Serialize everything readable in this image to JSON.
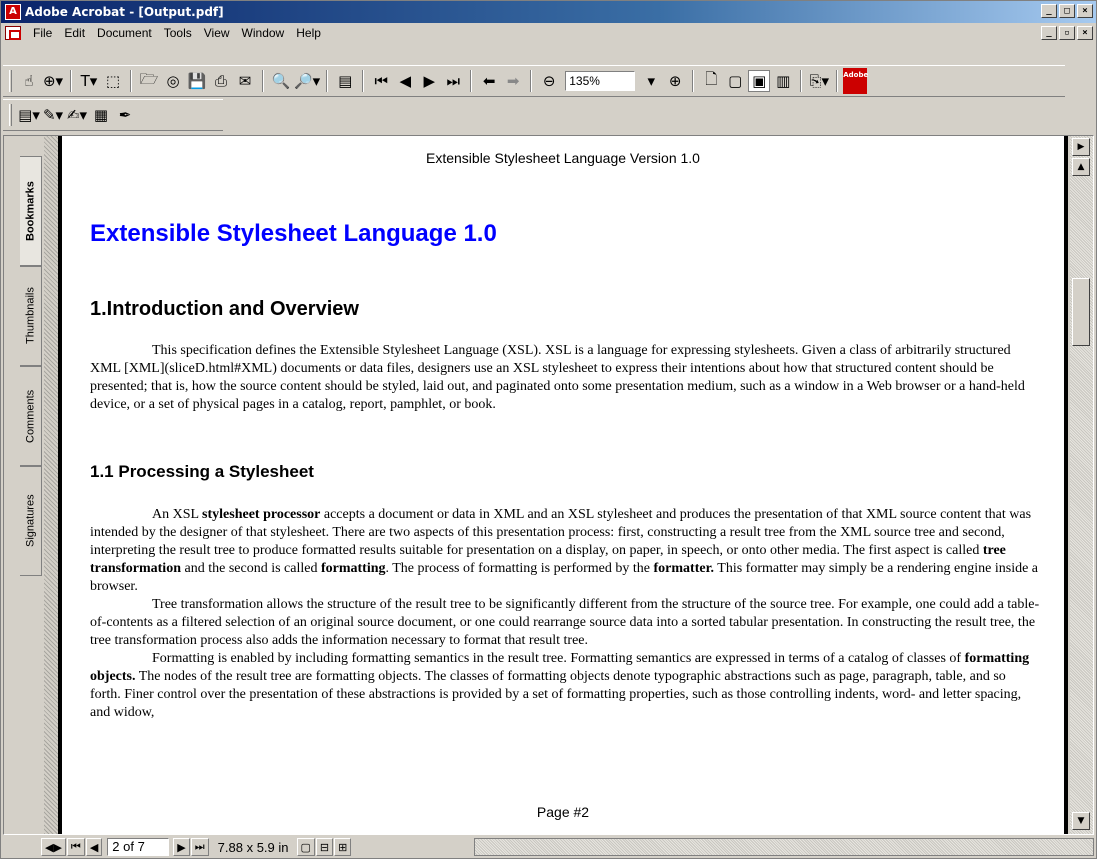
{
  "window": {
    "title": "Adobe Acrobat - [Output.pdf]"
  },
  "menu": [
    "File",
    "Edit",
    "Document",
    "Tools",
    "View",
    "Window",
    "Help"
  ],
  "toolbar": {
    "zoom_value": "135%",
    "adobe_label": "Adobe"
  },
  "nav_tabs": [
    "Bookmarks",
    "Thumbnails",
    "Comments",
    "Signatures"
  ],
  "document": {
    "running_header": "Extensible Stylesheet Language Version 1.0",
    "title": "Extensible Stylesheet Language 1.0",
    "section1_heading": "1.Introduction and Overview",
    "section1_para": "This specification defines the Extensible Stylesheet Language (XSL). XSL is a language for expressing stylesheets. Given a class of arbitrarily structured XML [XML](sliceD.html#XML) documents or data files, designers use an XSL stylesheet to express their intentions about how that structured content should be presented; that is, how the source content should be styled, laid out, and paginated onto some presentation medium, such as a window in a Web browser or a hand-held device, or a set of physical pages in a catalog, report, pamphlet, or book.",
    "section2_heading": "1.1 Processing a Stylesheet",
    "p2a": "An XSL ",
    "p2b": "stylesheet processor",
    "p2c": " accepts a document or data in XML and an XSL stylesheet and produces the presentation of that XML source content that was intended by the designer of that stylesheet. There are two aspects of this presentation process: first, constructing a result tree from the XML source tree and second, interpreting the result tree to produce formatted results suitable for presentation on a display, on paper, in speech, or onto other media. The first aspect is called ",
    "p2d": "tree transformation",
    "p2e": " and the second is called ",
    "p2f": "formatting",
    "p2g": ". The process of formatting is performed by the ",
    "p2h": "formatter.",
    "p2i": " This formatter may simply be a rendering engine inside a browser.",
    "p3": "Tree transformation allows the structure of the result tree to be significantly different from the structure of the source tree. For example, one could add a table-of-contents as a filtered selection of an original source document, or one could rearrange source data into a sorted tabular presentation. In constructing the result tree, the tree transformation process also adds the information necessary to format that result tree.",
    "p4a": "Formatting is enabled by including formatting semantics in the result tree. Formatting semantics are expressed in terms of a catalog of classes of ",
    "p4b": "formatting objects.",
    "p4c": " The nodes of the result tree are formatting objects. The classes of formatting objects denote typographic abstractions such as page, paragraph, table, and so forth. Finer control over the presentation of these abstractions is provided by a set of formatting properties, such as those controlling indents, word- and letter spacing, and widow,",
    "footer": "Page #2"
  },
  "status": {
    "page_indicator": "2 of 7",
    "page_size": "7.88 x 5.9 in"
  }
}
